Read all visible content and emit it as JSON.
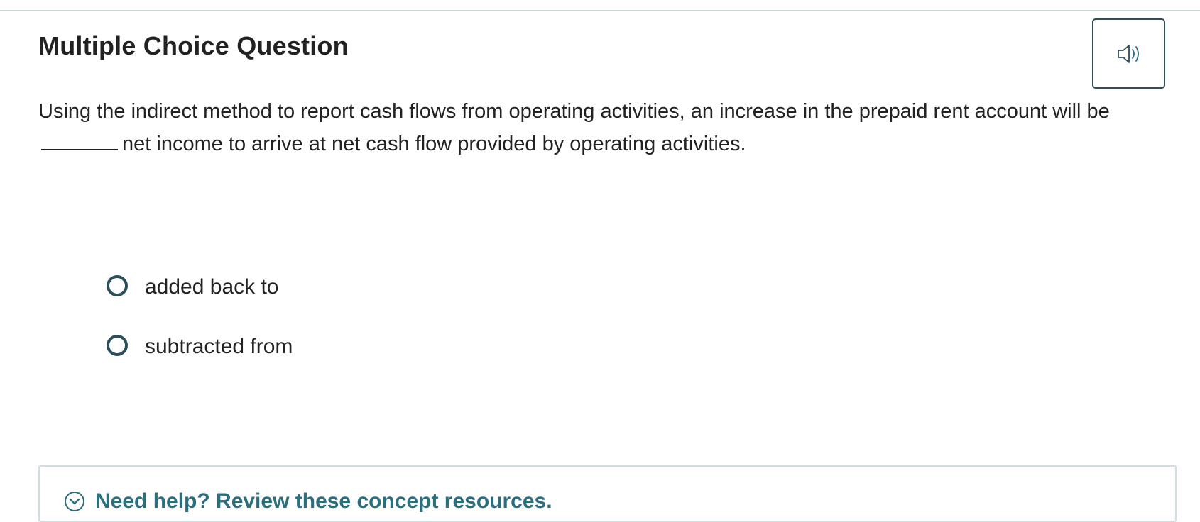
{
  "header": {
    "title": "Multiple Choice Question",
    "audio_icon": "speaker-icon"
  },
  "question": {
    "text_before": "Using the indirect method to report cash flows from operating activities, an increase in the prepaid rent account will be",
    "text_after": "net income to arrive at net cash flow provided by operating activities."
  },
  "options": [
    {
      "label": "added back to",
      "selected": false
    },
    {
      "label": "subtracted from",
      "selected": false
    }
  ],
  "help": {
    "label": "Need help? Review these concept resources.",
    "icon": "chevron-down-circle-icon"
  },
  "colors": {
    "accent": "#2b6f7f",
    "border_dark": "#2d4f5b",
    "rule": "#c9d6d8",
    "text": "#222222"
  }
}
